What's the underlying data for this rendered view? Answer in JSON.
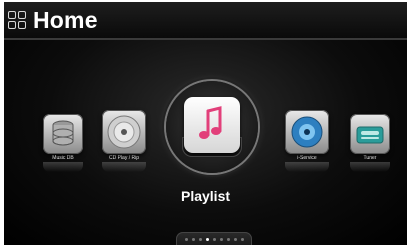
{
  "header": {
    "title": "Home",
    "icon": "grid-icon"
  },
  "menu": {
    "items": [
      {
        "label": "Music DB",
        "icon": "database-icon"
      },
      {
        "label": "CD Play / Rip",
        "icon": "cd-icon"
      },
      {
        "label": "Playlist",
        "icon": "music-note-icon",
        "selected": true
      },
      {
        "label": "i-Service",
        "icon": "globe-icon"
      },
      {
        "label": "Tuner",
        "icon": "radio-icon"
      }
    ],
    "selected_label": "Playlist"
  },
  "pager": {
    "page_count": 9,
    "current_page": 4
  },
  "colors": {
    "background": "#000000",
    "text": "#ffffff",
    "accent_pink": "#e23f7a",
    "service_blue": "#2d7fc0",
    "tuner_teal": "#2a9c9a"
  }
}
